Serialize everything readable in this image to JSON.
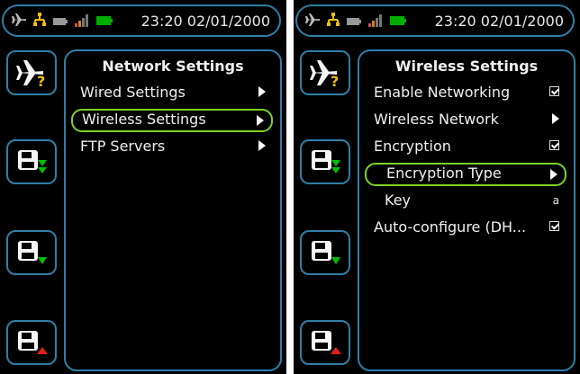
{
  "status": {
    "time": "23:20 02/01/2000"
  },
  "left": {
    "title": "Network Settings",
    "items": [
      {
        "label": "Wired Settings",
        "control": "arrow",
        "selected": false
      },
      {
        "label": "Wireless Settings",
        "control": "arrow",
        "selected": true
      },
      {
        "label": "FTP Servers",
        "control": "arrow",
        "selected": false
      }
    ]
  },
  "right": {
    "title": "Wireless Settings",
    "items": [
      {
        "label": "Enable Networking",
        "control": "checkbox"
      },
      {
        "label": "Wireless Network",
        "control": "arrow"
      },
      {
        "label": "Encryption",
        "control": "checkbox"
      },
      {
        "label": "Encryption Type",
        "control": "arrow",
        "selected": true,
        "indent": true
      },
      {
        "label": "Key",
        "control": "text",
        "value": "a",
        "indent": true
      },
      {
        "label": "Auto-configure (DH...",
        "control": "checkbox"
      }
    ]
  },
  "icons": {
    "airplane": "airplane-icon",
    "help": "question-mark-icon",
    "save_down_green": "save-down-green-icon",
    "save_down_green_small": "save-down-green-icon",
    "save_up_red": "save-up-red-icon",
    "status": [
      "airplane-icon",
      "network-icon",
      "battery-icon",
      "signal-icon",
      "battery-green-icon"
    ]
  },
  "colors": {
    "accent_blue": "#2f7fa6",
    "selected_green": "#7ed321",
    "background": "#000000",
    "text": "#f0f0f0"
  }
}
